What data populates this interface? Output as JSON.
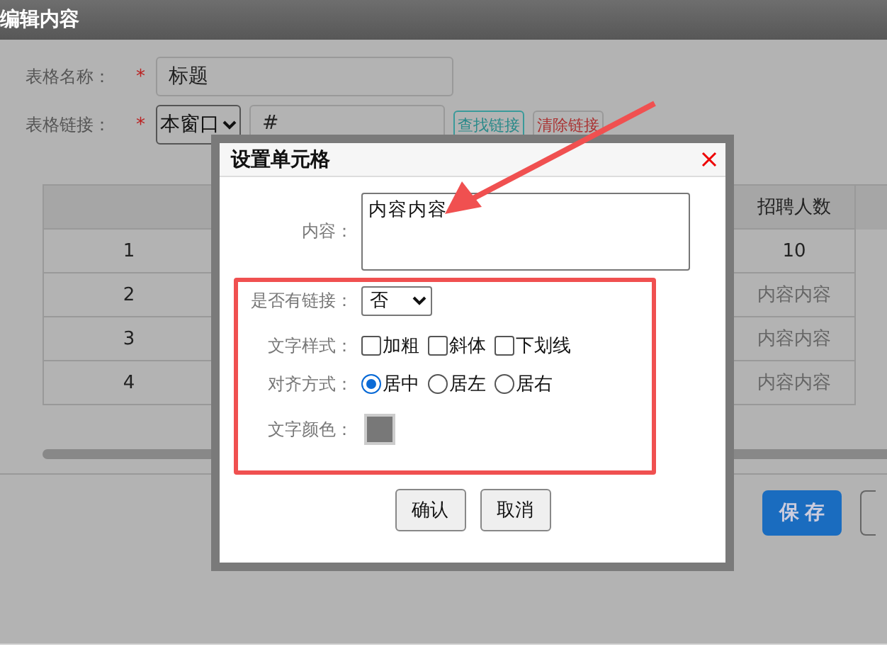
{
  "window": {
    "title": "编辑内容"
  },
  "form": {
    "name_label": "表格名称：",
    "name_required": "*",
    "name_value": "标题",
    "link_label": "表格链接：",
    "link_required": "*",
    "link_target": "本窗口",
    "link_value": "#",
    "buttons": [
      {
        "label": "查找链接",
        "kind": "find"
      },
      {
        "label": "清除链接",
        "kind": "clear"
      }
    ]
  },
  "table": {
    "last_column_header": "招聘人数",
    "rows": [
      {
        "index": "1",
        "last": "10",
        "muted": false
      },
      {
        "index": "2",
        "last": "内容内容",
        "muted": true
      },
      {
        "index": "3",
        "last": "内容内容",
        "muted": true
      },
      {
        "index": "4",
        "last": "内容内容",
        "muted": true
      }
    ]
  },
  "footer_buttons": [
    {
      "label": "保存",
      "kind": "primary"
    }
  ],
  "dialog": {
    "title": "设置单元格",
    "content_label": "内容：",
    "content_value": "内容内容",
    "link_label": "是否有链接：",
    "link_value": "否",
    "style_label": "文字样式：",
    "styles": [
      {
        "label": "加粗",
        "checked": false
      },
      {
        "label": "斜体",
        "checked": false
      },
      {
        "label": "下划线",
        "checked": false
      }
    ],
    "align_label": "对齐方式：",
    "aligns": [
      {
        "label": "居中",
        "selected": true
      },
      {
        "label": "居左",
        "selected": false
      },
      {
        "label": "居右",
        "selected": false
      }
    ],
    "color_label": "文字颜色：",
    "buttons": [
      {
        "label": "确认"
      },
      {
        "label": "取消"
      }
    ]
  }
}
